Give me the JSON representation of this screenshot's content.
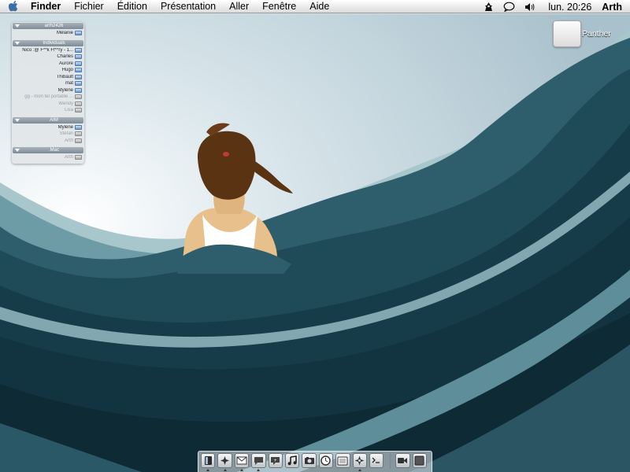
{
  "menubar": {
    "app": "Finder",
    "items": [
      "Fichier",
      "Édition",
      "Présentation",
      "Aller",
      "Fenêtre",
      "Aide"
    ],
    "clock": "lun. 20:26",
    "user": "Arth"
  },
  "buddy_list": {
    "groups": [
      {
        "name": "arth2426",
        "buddies": [
          {
            "name": "Mélanie",
            "idle": false
          }
        ]
      },
      {
        "name": "Individuals",
        "buddies": [
          {
            "name": "Nico :@ F**k Ff**ry - 1...",
            "idle": false
          },
          {
            "name": "Charles",
            "idle": false
          },
          {
            "name": "Aurore",
            "idle": false
          },
          {
            "name": "Hugo",
            "idle": false
          },
          {
            "name": "Thibault",
            "idle": false
          },
          {
            "name": "mat",
            "idle": false
          },
          {
            "name": "Mylène",
            "idle": false
          },
          {
            "name": "gg - mon tel portable ...",
            "idle": true
          },
          {
            "name": "Wendy",
            "idle": true
          },
          {
            "name": "Lisa",
            "idle": true
          }
        ]
      },
      {
        "name": "AIM",
        "buddies": [
          {
            "name": "Mylène",
            "idle": false
          },
          {
            "name": "Stefan",
            "idle": true
          },
          {
            "name": "Arth",
            "idle": true
          }
        ]
      },
      {
        "name": ".Mac",
        "buddies": [
          {
            "name": "Arth",
            "idle": true
          }
        ]
      }
    ]
  },
  "desktop": {
    "disk_label": "Panther"
  },
  "dock": {
    "items": [
      "finder-icon",
      "network-icon",
      "mail-icon",
      "ichat-icon",
      "ichat-bubble-icon",
      "itunes-icon",
      "iphoto-icon",
      "clock-icon",
      "preview-icon",
      "safari-icon",
      "terminal-icon",
      "ichat-av-icon",
      "window-icon"
    ]
  },
  "colors": {
    "sky": "#c9dae3",
    "wave_dark": "#123441",
    "wave_mid": "#2e5f6f",
    "wave_light": "#8fb6bf"
  }
}
